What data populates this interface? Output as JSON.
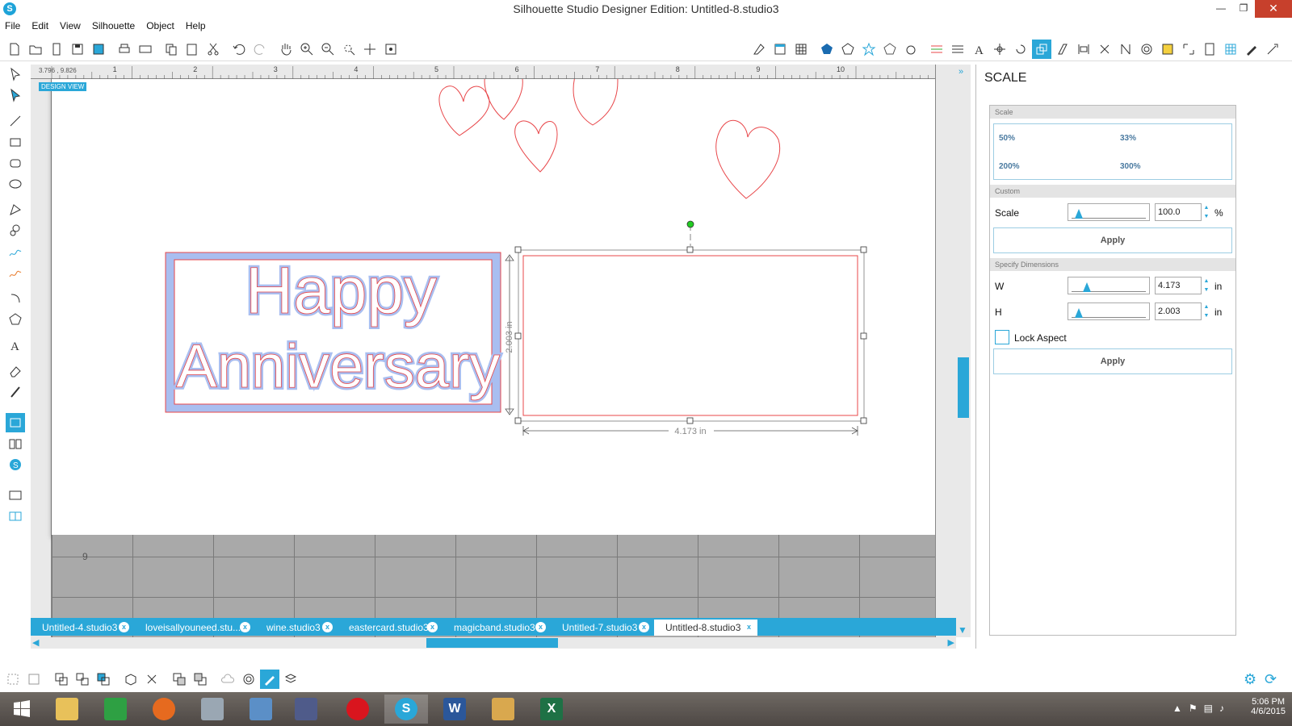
{
  "window": {
    "title": "Silhouette Studio Designer Edition: Untitled-8.studio3",
    "controls": {
      "minimize": "—",
      "maximize": "❐",
      "close": "✕"
    }
  },
  "menu": [
    "File",
    "Edit",
    "View",
    "Silhouette",
    "Object",
    "Help"
  ],
  "canvas": {
    "coords": "3.796 , 9.826",
    "design_view_label": "DESIGN VIEW",
    "ruler_numbers": [
      "1",
      "2",
      "3",
      "4",
      "5",
      "6",
      "7",
      "8",
      "9",
      "10"
    ],
    "grid_number": "9",
    "text_art": {
      "line1": "Happy",
      "line2": "Anniversary"
    },
    "height_dimension": "2.003 in",
    "width_dimension": "4.173 in",
    "colors": {
      "cut_line": "#e8474a",
      "fill": "#a9bef0",
      "selection": "#555555",
      "handle_rotate": "#22cc22"
    }
  },
  "scale_panel": {
    "title": "SCALE",
    "scale_section": "Scale",
    "presets": [
      "50%",
      "33%",
      "200%",
      "300%"
    ],
    "custom_section": "Custom",
    "scale_label": "Scale",
    "scale_value": "100.0",
    "scale_unit": "%",
    "apply_label": "Apply",
    "dimensions_section": "Specify Dimensions",
    "w_label": "W",
    "w_value": "4.173",
    "h_label": "H",
    "h_value": "2.003",
    "dim_unit": "in",
    "lock_aspect_label": "Lock Aspect",
    "lock_aspect_checked": false,
    "apply_label_2": "Apply"
  },
  "tabs": [
    {
      "label": "Untitled-4.studio3",
      "active": false
    },
    {
      "label": "loveisallyouneed.stu...",
      "active": false
    },
    {
      "label": "wine.studio3",
      "active": false
    },
    {
      "label": "eastercard.studio3",
      "active": false
    },
    {
      "label": "magicband.studio3",
      "active": false
    },
    {
      "label": "Untitled-7.studio3",
      "active": false
    },
    {
      "label": "Untitled-8.studio3",
      "active": true
    }
  ],
  "taskbar": {
    "apps": [
      "start",
      "file-explorer",
      "store",
      "firefox",
      "performance",
      "control-panel",
      "paint",
      "opera",
      "silhouette",
      "word",
      "maps",
      "excel"
    ],
    "time": "5:06 PM",
    "date": "4/6/2015"
  },
  "accent_color": "#2aa7d8"
}
